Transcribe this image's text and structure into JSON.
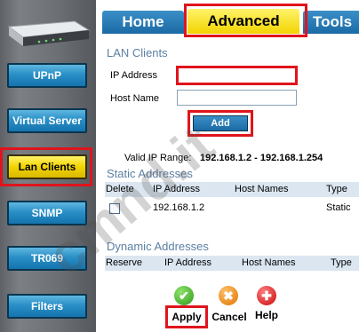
{
  "tabs": [
    {
      "label": "Home"
    },
    {
      "label": "Advanced"
    },
    {
      "label": "Tools"
    }
  ],
  "sidebar": {
    "items": [
      {
        "label": "UPnP"
      },
      {
        "label": "Virtual Server"
      },
      {
        "label": "Lan Clients",
        "active": true
      },
      {
        "label": "SNMP"
      },
      {
        "label": "TR069"
      },
      {
        "label": "Filters"
      }
    ]
  },
  "lan_clients": {
    "title": "LAN Clients",
    "ip_label": "IP Address",
    "ip_value": "",
    "host_label": "Host Name",
    "host_value": "",
    "add_label": "Add",
    "valid_range_label": "Valid IP Range:",
    "valid_range_value": "192.168.1.2 -  192.168.1.254"
  },
  "static_addresses": {
    "title": "Static Addresses",
    "headers": [
      "Delete",
      "IP Address",
      "Host Names",
      "Type"
    ],
    "rows": [
      {
        "ip": "192.168.1.2",
        "host": "",
        "type": "Static"
      }
    ]
  },
  "dynamic_addresses": {
    "title": "Dynamic Addresses",
    "headers": [
      "Reserve",
      "IP Address",
      "Host Names",
      "Type"
    ]
  },
  "actions": {
    "apply": "Apply",
    "cancel": "Cancel",
    "help": "Help"
  },
  "watermark": "cmnd.it",
  "colors": {
    "accent_red": "#e0141c",
    "tab_blue": "#1b6aa5",
    "active_yellow": "#f2d400",
    "section_title": "#5b7fa3"
  }
}
